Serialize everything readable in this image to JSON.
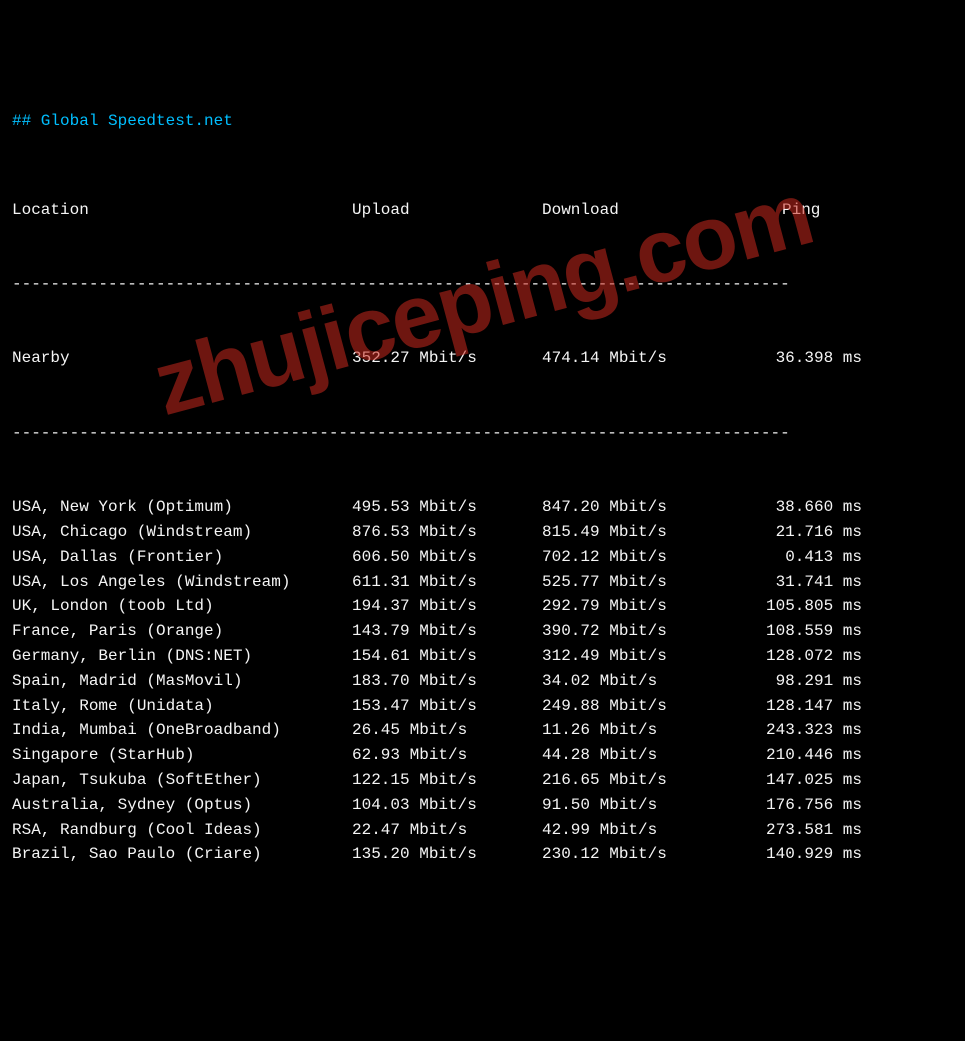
{
  "title": "## Global Speedtest.net",
  "headers": {
    "location": "Location",
    "upload": "Upload",
    "download": "Download",
    "ping": "Ping"
  },
  "divider": "---------------------------------------------------------------------------------",
  "nearby": {
    "location": "Nearby",
    "upload": "352.27 Mbit/s",
    "download": "474.14 Mbit/s",
    "ping": "36.398 ms"
  },
  "chart_data": {
    "type": "table",
    "title": "Global Speedtest.net",
    "columns": [
      "Location",
      "Upload",
      "Download",
      "Ping"
    ],
    "rows": [
      {
        "location": "Nearby",
        "upload_mbits": 352.27,
        "download_mbits": 474.14,
        "ping_ms": 36.398
      },
      {
        "location": "USA, New York (Optimum)",
        "upload_mbits": 495.53,
        "download_mbits": 847.2,
        "ping_ms": 38.66
      },
      {
        "location": "USA, Chicago (Windstream)",
        "upload_mbits": 876.53,
        "download_mbits": 815.49,
        "ping_ms": 21.716
      },
      {
        "location": "USA, Dallas (Frontier)",
        "upload_mbits": 606.5,
        "download_mbits": 702.12,
        "ping_ms": 0.413
      },
      {
        "location": "USA, Los Angeles (Windstream)",
        "upload_mbits": 611.31,
        "download_mbits": 525.77,
        "ping_ms": 31.741
      },
      {
        "location": "UK, London (toob Ltd)",
        "upload_mbits": 194.37,
        "download_mbits": 292.79,
        "ping_ms": 105.805
      },
      {
        "location": "France, Paris (Orange)",
        "upload_mbits": 143.79,
        "download_mbits": 390.72,
        "ping_ms": 108.559
      },
      {
        "location": "Germany, Berlin (DNS:NET)",
        "upload_mbits": 154.61,
        "download_mbits": 312.49,
        "ping_ms": 128.072
      },
      {
        "location": "Spain, Madrid (MasMovil)",
        "upload_mbits": 183.7,
        "download_mbits": 34.02,
        "ping_ms": 98.291
      },
      {
        "location": "Italy, Rome (Unidata)",
        "upload_mbits": 153.47,
        "download_mbits": 249.88,
        "ping_ms": 128.147
      },
      {
        "location": "India, Mumbai (OneBroadband)",
        "upload_mbits": 26.45,
        "download_mbits": 11.26,
        "ping_ms": 243.323
      },
      {
        "location": "Singapore (StarHub)",
        "upload_mbits": 62.93,
        "download_mbits": 44.28,
        "ping_ms": 210.446
      },
      {
        "location": "Japan, Tsukuba (SoftEther)",
        "upload_mbits": 122.15,
        "download_mbits": 216.65,
        "ping_ms": 147.025
      },
      {
        "location": "Australia, Sydney (Optus)",
        "upload_mbits": 104.03,
        "download_mbits": 91.5,
        "ping_ms": 176.756
      },
      {
        "location": "RSA, Randburg (Cool Ideas)",
        "upload_mbits": 22.47,
        "download_mbits": 42.99,
        "ping_ms": 273.581
      },
      {
        "location": "Brazil, Sao Paulo (Criare)",
        "upload_mbits": 135.2,
        "download_mbits": 230.12,
        "ping_ms": 140.929
      }
    ]
  },
  "rows": [
    {
      "location": "USA, New York (Optimum)",
      "upload": "495.53 Mbit/s",
      "download": "847.20 Mbit/s",
      "ping": "38.660 ms"
    },
    {
      "location": "USA, Chicago (Windstream)",
      "upload": "876.53 Mbit/s",
      "download": "815.49 Mbit/s",
      "ping": "21.716 ms"
    },
    {
      "location": "USA, Dallas (Frontier)",
      "upload": "606.50 Mbit/s",
      "download": "702.12 Mbit/s",
      "ping": "0.413 ms"
    },
    {
      "location": "USA, Los Angeles (Windstream)",
      "upload": "611.31 Mbit/s",
      "download": "525.77 Mbit/s",
      "ping": "31.741 ms"
    },
    {
      "location": "UK, London (toob Ltd)",
      "upload": "194.37 Mbit/s",
      "download": "292.79 Mbit/s",
      "ping": "105.805 ms"
    },
    {
      "location": "France, Paris (Orange)",
      "upload": "143.79 Mbit/s",
      "download": "390.72 Mbit/s",
      "ping": "108.559 ms"
    },
    {
      "location": "Germany, Berlin (DNS:NET)",
      "upload": "154.61 Mbit/s",
      "download": "312.49 Mbit/s",
      "ping": "128.072 ms"
    },
    {
      "location": "Spain, Madrid (MasMovil)",
      "upload": "183.70 Mbit/s",
      "download": "34.02 Mbit/s",
      "ping": "98.291 ms"
    },
    {
      "location": "Italy, Rome (Unidata)",
      "upload": "153.47 Mbit/s",
      "download": "249.88 Mbit/s",
      "ping": "128.147 ms"
    },
    {
      "location": "India, Mumbai (OneBroadband)",
      "upload": "26.45 Mbit/s",
      "download": "11.26 Mbit/s",
      "ping": "243.323 ms"
    },
    {
      "location": "Singapore (StarHub)",
      "upload": "62.93 Mbit/s",
      "download": "44.28 Mbit/s",
      "ping": "210.446 ms"
    },
    {
      "location": "Japan, Tsukuba (SoftEther)",
      "upload": "122.15 Mbit/s",
      "download": "216.65 Mbit/s",
      "ping": "147.025 ms"
    },
    {
      "location": "Australia, Sydney (Optus)",
      "upload": "104.03 Mbit/s",
      "download": "91.50 Mbit/s",
      "ping": "176.756 ms"
    },
    {
      "location": "RSA, Randburg (Cool Ideas)",
      "upload": "22.47 Mbit/s",
      "download": "42.99 Mbit/s",
      "ping": "273.581 ms"
    },
    {
      "location": "Brazil, Sao Paulo (Criare)",
      "upload": "135.20 Mbit/s",
      "download": "230.12 Mbit/s",
      "ping": "140.929 ms"
    }
  ],
  "watermark": "zhujiceping.com"
}
